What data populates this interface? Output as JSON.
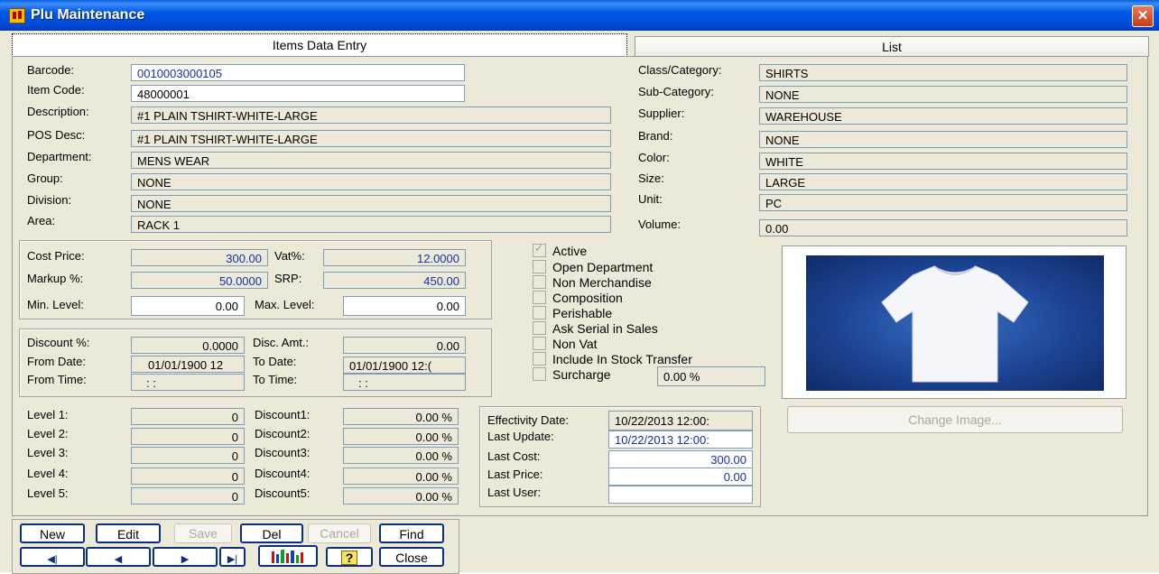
{
  "window": {
    "title": "Plu Maintenance",
    "close_glyph": "✕",
    "icon": "app-icon"
  },
  "tabs": [
    {
      "label": "Items Data Entry"
    },
    {
      "label": "List"
    }
  ],
  "left_fields": [
    {
      "label": "Barcode:",
      "value": "0010003000105"
    },
    {
      "label": "Item Code:",
      "value": "48000001"
    },
    {
      "label": "Description:",
      "value": "#1 PLAIN TSHIRT-WHITE-LARGE"
    },
    {
      "label": "POS Desc:",
      "value": "#1 PLAIN TSHIRT-WHITE-LARGE"
    },
    {
      "label": "Department:",
      "value": "MENS WEAR"
    },
    {
      "label": "Group:",
      "value": "NONE"
    },
    {
      "label": "Division:",
      "value": "NONE"
    },
    {
      "label": "Area:",
      "value": "RACK 1"
    }
  ],
  "right_fields": [
    {
      "label": "Class/Category:",
      "value": "SHIRTS"
    },
    {
      "label": "Sub-Category:",
      "value": "NONE"
    },
    {
      "label": "Supplier:",
      "value": "WAREHOUSE"
    },
    {
      "label": "Brand:",
      "value": "NONE"
    },
    {
      "label": "Color:",
      "value": "WHITE"
    },
    {
      "label": "Size:",
      "value": "LARGE"
    },
    {
      "label": "Unit:",
      "value": "PC"
    },
    {
      "label": "Volume:",
      "value": "0.00"
    }
  ],
  "pricing": {
    "cost_price_label": "Cost Price:",
    "cost_price": "300.00",
    "vat_label": "Vat%:",
    "vat": "12.0000",
    "markup_label": "Markup %:",
    "markup": "50.0000",
    "srp_label": "SRP:",
    "srp": "450.00",
    "min_label": "Min. Level:",
    "min": "0.00",
    "max_label": "Max. Level:",
    "max": "0.00"
  },
  "discount": {
    "pct_label": "Discount %:",
    "pct": "0.0000",
    "amt_label": "Disc. Amt.:",
    "amt": "0.00",
    "from_date_label": "From Date:",
    "from_date": "01/01/1900 12",
    "to_date_label": "To Date:",
    "to_date": "01/01/1900 12:(",
    "from_time_label": "From Time:",
    "from_time": ": :",
    "to_time_label": "To Time:",
    "to_time": ": :"
  },
  "options": [
    {
      "label": "Active",
      "checked": true
    },
    {
      "label": "Open Department",
      "checked": false
    },
    {
      "label": "Non Merchandise",
      "checked": false
    },
    {
      "label": "Composition",
      "checked": false
    },
    {
      "label": "Perishable",
      "checked": false
    },
    {
      "label": "Ask Serial in Sales",
      "checked": false
    },
    {
      "label": "Non Vat",
      "checked": false
    },
    {
      "label": "Include In Stock Transfer",
      "checked": false
    },
    {
      "label": "Surcharge",
      "checked": false
    }
  ],
  "surcharge_value": "0.00 %",
  "levels": [
    {
      "label": "Level 1:",
      "value": "0",
      "disc_label": "Discount1:",
      "disc": "0.00 %"
    },
    {
      "label": "Level 2:",
      "value": "0",
      "disc_label": "Discount2:",
      "disc": "0.00 %"
    },
    {
      "label": "Level 3:",
      "value": "0",
      "disc_label": "Discount3:",
      "disc": "0.00 %"
    },
    {
      "label": "Level 4:",
      "value": "0",
      "disc_label": "Discount4:",
      "disc": "0.00 %"
    },
    {
      "label": "Level 5:",
      "value": "0",
      "disc_label": "Discount5:",
      "disc": "0.00 %"
    }
  ],
  "history": {
    "effectivity_label": "Effectivity Date:",
    "effectivity": "10/22/2013 12:00:",
    "last_update_label": "Last Update:",
    "last_update": "10/22/2013 12:00:",
    "last_cost_label": "Last Cost:",
    "last_cost": "300.00",
    "last_price_label": "Last Price:",
    "last_price": "0.00",
    "last_user_label": "Last User:",
    "last_user": ""
  },
  "image": {
    "change_label": "Change Image..."
  },
  "toolbar": {
    "new": "New",
    "edit": "Edit",
    "save": "Save",
    "del": "Del",
    "cancel": "Cancel",
    "find": "Find",
    "close": "Close",
    "first_glyph": "◀|",
    "prev_glyph": "◀",
    "next_glyph": "▶",
    "last_glyph": "▶|",
    "help_glyph": "?"
  },
  "colors": {
    "title_bar": "#0058e6",
    "face": "#ece9d8",
    "value_blue": "#1530a8",
    "close_red": "#d84a24"
  }
}
